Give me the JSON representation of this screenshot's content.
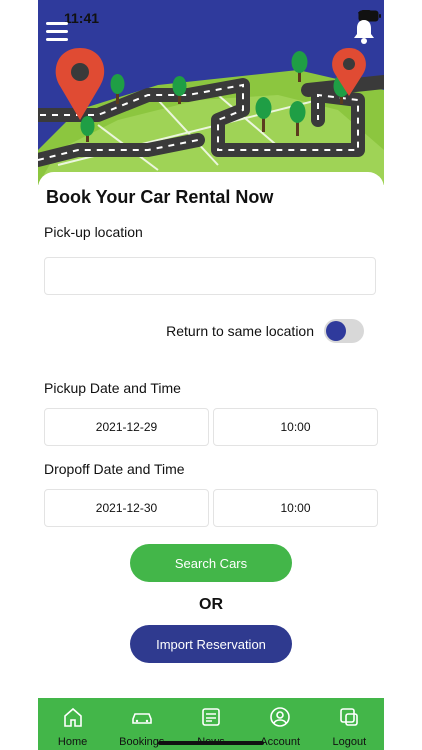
{
  "status": {
    "time": "11:41"
  },
  "hero": {
    "description": "map-illustration"
  },
  "booking": {
    "title": "Book Your Car Rental Now",
    "pickup_location_label": "Pick-up location",
    "pickup_location_value": "",
    "pickup_location_placeholder": "",
    "return_same_location_label": "Return to same location",
    "return_same_location_on": true,
    "pickup_datetime_label": "Pickup Date and Time",
    "pickup_date": "2021-12-29",
    "pickup_time": "10:00",
    "dropoff_datetime_label": "Dropoff Date and Time",
    "dropoff_date": "2021-12-30",
    "dropoff_time": "10:00",
    "search_button_label": "Search Cars",
    "or_label": "OR",
    "import_button_label": "Import Reservation"
  },
  "nav": {
    "items": [
      {
        "label": "Home",
        "icon": "home-icon"
      },
      {
        "label": "Bookings",
        "icon": "car-icon"
      },
      {
        "label": "News",
        "icon": "newspaper-icon"
      },
      {
        "label": "Account",
        "icon": "account-icon"
      },
      {
        "label": "Logout",
        "icon": "logout-icon"
      }
    ]
  },
  "colors": {
    "brand_blue": "#2f3a9c",
    "brand_green": "#43b649"
  }
}
